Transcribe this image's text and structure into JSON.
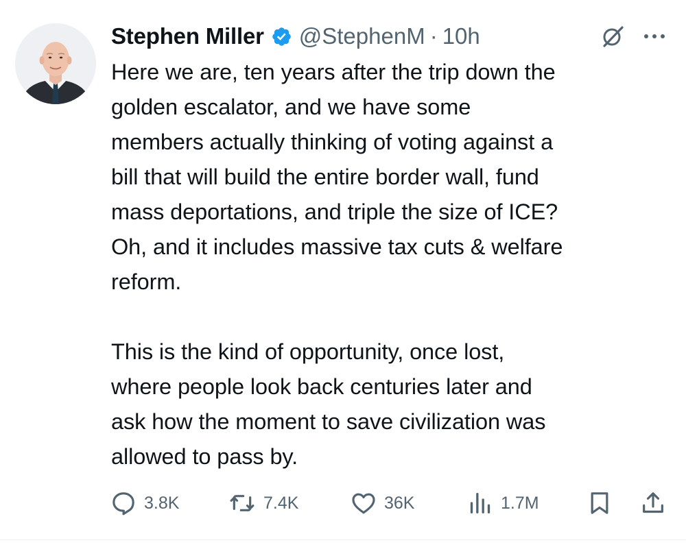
{
  "author": {
    "display_name": "Stephen Miller",
    "handle": "@StephenM",
    "separator": "·",
    "time": "10h",
    "verified_icon": "verified-badge-icon",
    "avatar_icon": "profile-photo"
  },
  "tweet": {
    "text": "Here we are, ten years after the trip down the\ngolden escalator, and we have some\nmembers actually thinking of voting against a\nbill that will build the entire border wall, fund\nmass deportations, and triple the size of ICE?\nOh, and it includes massive tax cuts & welfare\nreform.\n\nThis is the kind of opportunity, once lost,\nwhere people look back centuries later and\nask how the moment to save civilization was\nallowed to pass by."
  },
  "header_icons": [
    "grok-icon",
    "more-icon"
  ],
  "actions": {
    "replies": "3.8K",
    "reposts": "7.4K",
    "likes": "36K",
    "views": "1.7M",
    "icons": [
      "reply-icon",
      "repost-icon",
      "like-icon",
      "views-icon",
      "bookmark-icon",
      "share-icon"
    ]
  },
  "colors": {
    "text": "#0f1419",
    "secondary": "#536471",
    "verified": "#1d9bf0",
    "background": "#ffffff"
  }
}
